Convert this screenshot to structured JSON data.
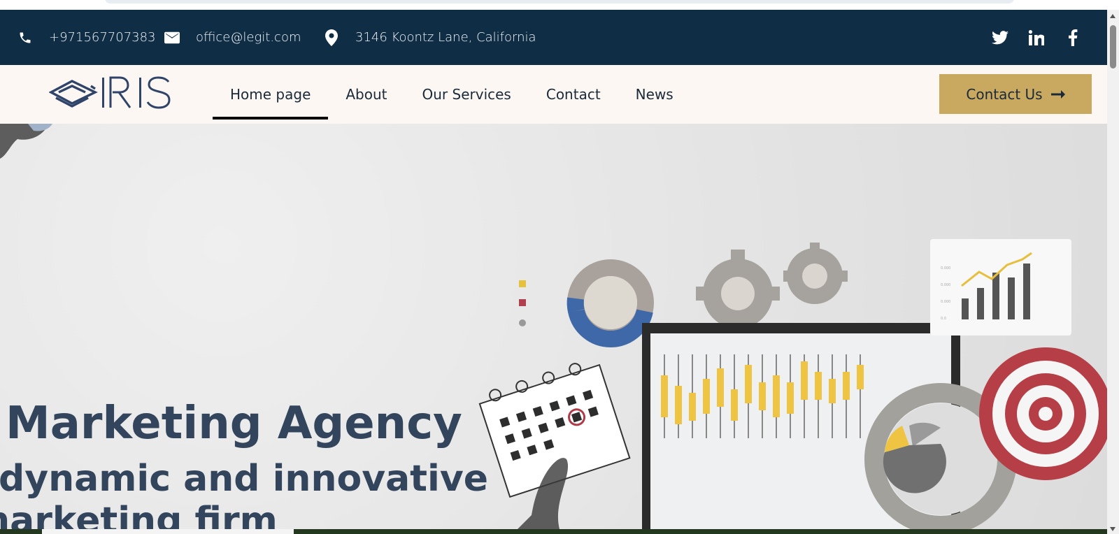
{
  "topbar": {
    "phone": "+971567707383",
    "email": "office@legit.com",
    "address": "3146 Koontz Lane, California",
    "social": [
      "twitter-icon",
      "linkedin-icon",
      "facebook-icon"
    ]
  },
  "nav": {
    "logo_text": "IRIS",
    "links": [
      {
        "label": "Home page",
        "active": true
      },
      {
        "label": "About",
        "active": false
      },
      {
        "label": "Our Services",
        "active": false
      },
      {
        "label": "Contact",
        "active": false
      },
      {
        "label": "News",
        "active": false
      }
    ],
    "cta_label": "Contact Us",
    "cta_icon": "arrow-right-icon"
  },
  "hero": {
    "title": "Marketing Agency",
    "subtitle_line1": "dynamic and innovative",
    "subtitle_line2": "marketing firm"
  },
  "colors": {
    "topbar_bg": "#0f2d44",
    "nav_bg": "#fcf7f2",
    "accent_gold": "#c9a960",
    "heading": "#33455c"
  }
}
